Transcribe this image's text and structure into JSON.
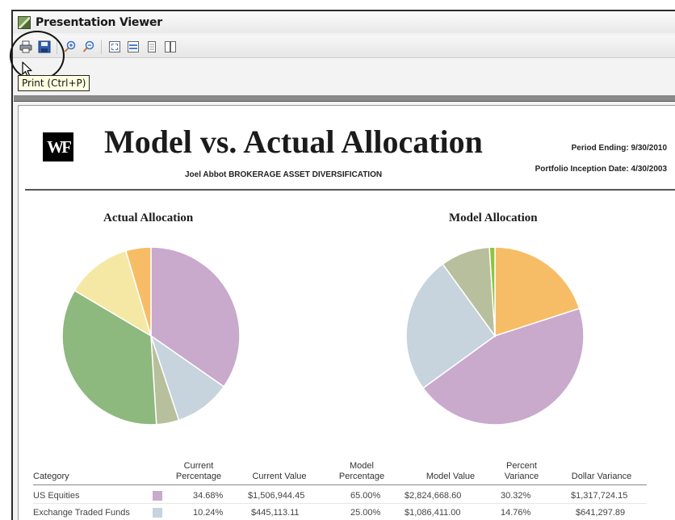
{
  "window": {
    "title": "Presentation Viewer"
  },
  "toolbar": {
    "buttons": [
      {
        "icon": "print-icon"
      },
      {
        "icon": "save-icon"
      },
      {
        "icon": "zoom-in-icon"
      },
      {
        "icon": "zoom-out-icon"
      },
      {
        "icon": "fit-page-icon"
      },
      {
        "icon": "fit-width-icon"
      },
      {
        "icon": "single-page-icon"
      },
      {
        "icon": "two-page-icon"
      }
    ],
    "tooltip": "Print (Ctrl+P)"
  },
  "report": {
    "logo_text": "WF",
    "title": "Model vs. Actual Allocation",
    "subtitle": "Joel Abbot BROKERAGE ASSET DIVERSIFICATION",
    "period_ending": "Period Ending: 9/30/2010",
    "inception": "Portfolio Inception Date: 4/30/2003"
  },
  "colors": {
    "lavender": "#c9a9cc",
    "light_blue": "#c7d4de",
    "olive": "#b8bf9c",
    "green": "#8db87e",
    "cream": "#f4e8a4",
    "orange": "#f7bd66",
    "bright_green": "#8fc43d"
  },
  "chart_data": [
    {
      "type": "pie",
      "title": "Actual Allocation",
      "slices": [
        {
          "value": 34.68,
          "color": "#c9a9cc"
        },
        {
          "value": 10.24,
          "color": "#c7d4de"
        },
        {
          "value": 4.1,
          "color": "#b8bf9c"
        },
        {
          "value": 34.5,
          "color": "#8db87e"
        },
        {
          "value": 11.9,
          "color": "#f4e8a4"
        },
        {
          "value": 4.58,
          "color": "#f7bd66"
        }
      ]
    },
    {
      "type": "pie",
      "title": "Model Allocation",
      "slices": [
        {
          "value": 20.0,
          "color": "#f7bd66"
        },
        {
          "value": 45.0,
          "color": "#c9a9cc"
        },
        {
          "value": 25.0,
          "color": "#c7d4de"
        },
        {
          "value": 9.0,
          "color": "#b8bf9c"
        },
        {
          "value": 1.0,
          "color": "#8fc43d"
        }
      ]
    }
  ],
  "table": {
    "headers": {
      "category": "Category",
      "current_pct": [
        "Current",
        "Percentage"
      ],
      "current_value": "Current Value",
      "model_pct": [
        "Model",
        "Percentage"
      ],
      "model_value": "Model Value",
      "pct_variance": [
        "Percent",
        "Variance"
      ],
      "dollar_variance": "Dollar Variance"
    },
    "rows": [
      {
        "category": "US Equities",
        "color": "#c9a9cc",
        "current_pct": "34.68%",
        "current_value": "$1,506,944.45",
        "model_pct": "65.00%",
        "model_value": "$2,824,668.60",
        "pct_variance": "30.32%",
        "dollar_variance": "$1,317,724.15"
      },
      {
        "category": "Exchange Traded Funds",
        "color": "#c7d4de",
        "current_pct": "10.24%",
        "current_value": "$445,113.11",
        "model_pct": "25.00%",
        "model_value": "$1,086,411.00",
        "pct_variance": "14.76%",
        "dollar_variance": "$641,297.89"
      }
    ]
  }
}
